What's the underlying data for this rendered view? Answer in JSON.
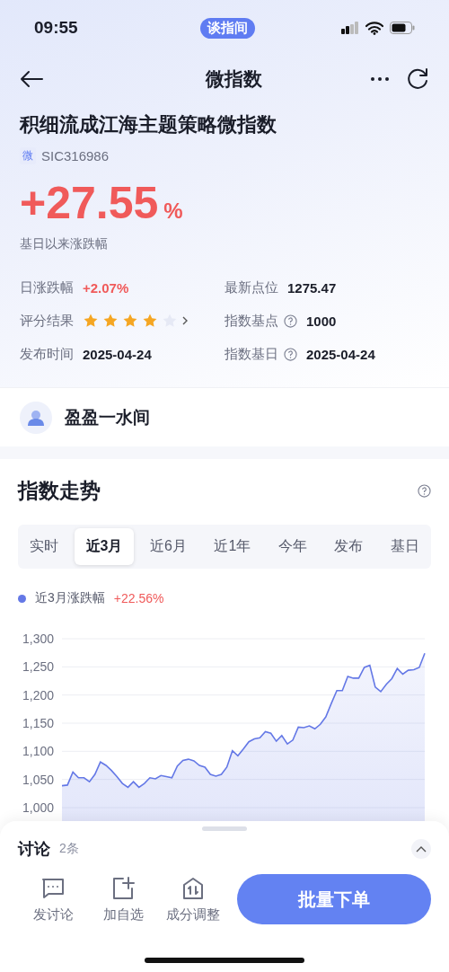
{
  "status_bar": {
    "time": "09:55",
    "app_badge": "谈指间"
  },
  "nav": {
    "title": "微指数"
  },
  "index": {
    "name": "积细流成江海主题策略微指数",
    "tag": "微",
    "code": "SIC316986",
    "change": "+27.55",
    "change_unit": "%",
    "change_label": "基日以来涨跌幅"
  },
  "info": [
    {
      "kind": "change",
      "label": "日涨跌幅",
      "value": "+2.07%",
      "help": false
    },
    {
      "kind": "text",
      "label": "最新点位",
      "value": "1275.47",
      "help": false
    },
    {
      "kind": "stars",
      "label": "评分结果",
      "stars": 4
    },
    {
      "kind": "text",
      "label": "指数基点",
      "value": "1000",
      "help": true
    },
    {
      "kind": "text",
      "label": "发布时间",
      "value": "2025-04-24",
      "help": false
    },
    {
      "kind": "text",
      "label": "指数基日",
      "value": "2025-04-24",
      "help": true
    }
  ],
  "author": {
    "name": "盈盈一水间"
  },
  "trend": {
    "title": "指数走势",
    "tabs": [
      {
        "label": "实时",
        "selected": false
      },
      {
        "label": "近3月",
        "selected": true
      },
      {
        "label": "近6月",
        "selected": false
      },
      {
        "label": "近1年",
        "selected": false
      },
      {
        "label": "今年",
        "selected": false
      },
      {
        "label": "发布",
        "selected": false
      },
      {
        "label": "基日",
        "selected": false
      }
    ],
    "legend": {
      "value": "+22.56%"
    },
    "chart_data": {
      "type": "area",
      "grid": true,
      "ylim": [
        1000,
        1300
      ],
      "yticks": [
        {
          "value": 1000,
          "label": "1,000"
        },
        {
          "value": 1050,
          "label": "1,050"
        },
        {
          "value": 1100,
          "label": "1,100"
        },
        {
          "value": 1150,
          "label": "1,150"
        },
        {
          "value": 1200,
          "label": "1,200"
        },
        {
          "value": 1250,
          "label": "1,250"
        },
        {
          "value": 1300,
          "label": "1,300"
        }
      ],
      "series": [
        {
          "name": "近3月涨跌幅",
          "color": "#6478e6",
          "values": [
            1039,
            1040,
            1063,
            1053,
            1053,
            1046,
            1059,
            1081,
            1075,
            1066,
            1055,
            1043,
            1036,
            1046,
            1036,
            1043,
            1053,
            1051,
            1057,
            1055,
            1053,
            1074,
            1084,
            1086,
            1083,
            1075,
            1072,
            1059,
            1056,
            1059,
            1072,
            1101,
            1092,
            1104,
            1117,
            1122,
            1124,
            1135,
            1132,
            1118,
            1128,
            1113,
            1120,
            1143,
            1142,
            1145,
            1140,
            1148,
            1161,
            1185,
            1208,
            1208,
            1233,
            1230,
            1230,
            1249,
            1253,
            1214,
            1206,
            1219,
            1229,
            1247,
            1237,
            1244,
            1245,
            1249,
            1274
          ]
        }
      ]
    }
  },
  "discussion": {
    "title": "讨论",
    "count": "2条"
  },
  "actions": [
    {
      "kind": "comment",
      "label": "发讨论"
    },
    {
      "kind": "add",
      "label": "加自选"
    },
    {
      "kind": "adjust",
      "label": "成分调整"
    }
  ],
  "primary_button": "批量下单"
}
